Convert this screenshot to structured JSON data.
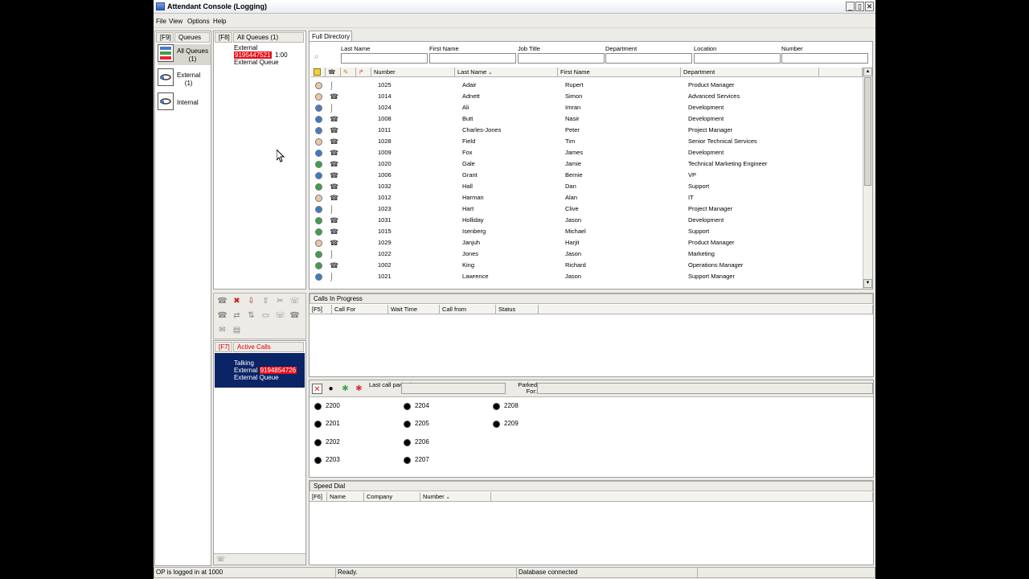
{
  "window": {
    "title": "Attendant Console (Logging)",
    "controls": [
      "_",
      "▯",
      "✕"
    ]
  },
  "menu": [
    "File",
    "View",
    "Options",
    "Help"
  ],
  "queues_panel": {
    "key": "[F9]",
    "title": "Queues",
    "items": [
      {
        "label": "All Queues",
        "count": "(1)"
      },
      {
        "label": "External",
        "count": "(1)"
      },
      {
        "label": "Internal",
        "count": ""
      }
    ]
  },
  "queue_calls": {
    "key": "[F8]",
    "title": "All Queues (1)",
    "call": {
      "line1": "External",
      "number": "9195447521",
      "time": "1:00",
      "queue": "External Queue"
    }
  },
  "directory": {
    "tab": "Full Directory",
    "search_labels": [
      "Last Name",
      "First Name",
      "Job Title",
      "Department",
      "Location",
      "Number"
    ],
    "columns": [
      "Number",
      "Last Name",
      "First Name",
      "Department"
    ],
    "sort_indicator": "▲",
    "rows": [
      {
        "status": "idle",
        "device": "handset",
        "number": "1025",
        "last": "Adair",
        "first": "Rupert",
        "dept": "Product Manager"
      },
      {
        "status": "idle",
        "device": "phone",
        "number": "1014",
        "last": "Adnett",
        "first": "Simon",
        "dept": "Advanced Services"
      },
      {
        "status": "busy",
        "device": "handset",
        "number": "1024",
        "last": "Ali",
        "first": "Imran",
        "dept": "Development"
      },
      {
        "status": "away",
        "device": "phone",
        "number": "1008",
        "last": "Butt",
        "first": "Nasir",
        "dept": "Development"
      },
      {
        "status": "busy",
        "device": "phone",
        "number": "1011",
        "last": "Charles-Jones",
        "first": "Peter",
        "dept": "Project Manager"
      },
      {
        "status": "idle",
        "device": "phone",
        "number": "1028",
        "last": "Field",
        "first": "Tim",
        "dept": "Senior Technical Services"
      },
      {
        "status": "away",
        "device": "phone",
        "number": "1009",
        "last": "Fox",
        "first": "James",
        "dept": "Development"
      },
      {
        "status": "available",
        "device": "phone",
        "number": "1020",
        "last": "Gale",
        "first": "Jamie",
        "dept": "Technical Marketing Engineer"
      },
      {
        "status": "away",
        "device": "phone",
        "number": "1006",
        "last": "Grant",
        "first": "Bernie",
        "dept": "VP"
      },
      {
        "status": "available",
        "device": "phone",
        "number": "1032",
        "last": "Hall",
        "first": "Dan",
        "dept": "Support"
      },
      {
        "status": "idle",
        "device": "phone",
        "number": "1012",
        "last": "Harman",
        "first": "Alan",
        "dept": "IT"
      },
      {
        "status": "away",
        "device": "handset",
        "number": "1023",
        "last": "Hart",
        "first": "Clive",
        "dept": "Project Manager"
      },
      {
        "status": "available",
        "device": "phone",
        "number": "1031",
        "last": "Holliday",
        "first": "Jason",
        "dept": "Development"
      },
      {
        "status": "available",
        "device": "phone",
        "number": "1015",
        "last": "Isenberg",
        "first": "Michael",
        "dept": "Support"
      },
      {
        "status": "idle",
        "device": "phone",
        "number": "1029",
        "last": "Janjuh",
        "first": "Harjit",
        "dept": "Product Manager"
      },
      {
        "status": "available",
        "device": "handset",
        "number": "1022",
        "last": "Jones",
        "first": "Jason",
        "dept": "Marketing"
      },
      {
        "status": "available",
        "device": "phone",
        "number": "1002",
        "last": "King",
        "first": "Richard",
        "dept": "Operations Manager"
      },
      {
        "status": "away",
        "device": "handset",
        "number": "1021",
        "last": "Lawrence",
        "first": "Jason",
        "dept": "Support Manager"
      }
    ],
    "status_colors": {
      "idle": "#e8c8a8",
      "busy": "#4a7bc4",
      "away": "#3c7ac8",
      "available": "#3ca04a"
    }
  },
  "active_calls": {
    "key": "[F7]",
    "title": "Active Calls",
    "call": {
      "state": "Talking",
      "line1": "External",
      "number": "9194854726",
      "queue": "External Queue"
    }
  },
  "calls_in_progress": {
    "title": "Calls In Progress",
    "columns": [
      "[F5]",
      "Call For",
      "Wait Time",
      "Call from",
      "Status"
    ]
  },
  "park": {
    "last_call_label": "Last call parked at:",
    "parked_for_label": "Parked For:",
    "slots": [
      "2200",
      "2201",
      "2202",
      "2203",
      "2204",
      "2205",
      "2206",
      "2207",
      "2208",
      "2209"
    ]
  },
  "speed_dial": {
    "title": "Speed Dial",
    "columns": [
      "[F6]",
      "Name",
      "Company",
      "Number"
    ],
    "sort_indicator": "▲"
  },
  "status_bar": {
    "login": "OP is logged in at 1000",
    "state": "Ready.",
    "db": "Database connected"
  }
}
